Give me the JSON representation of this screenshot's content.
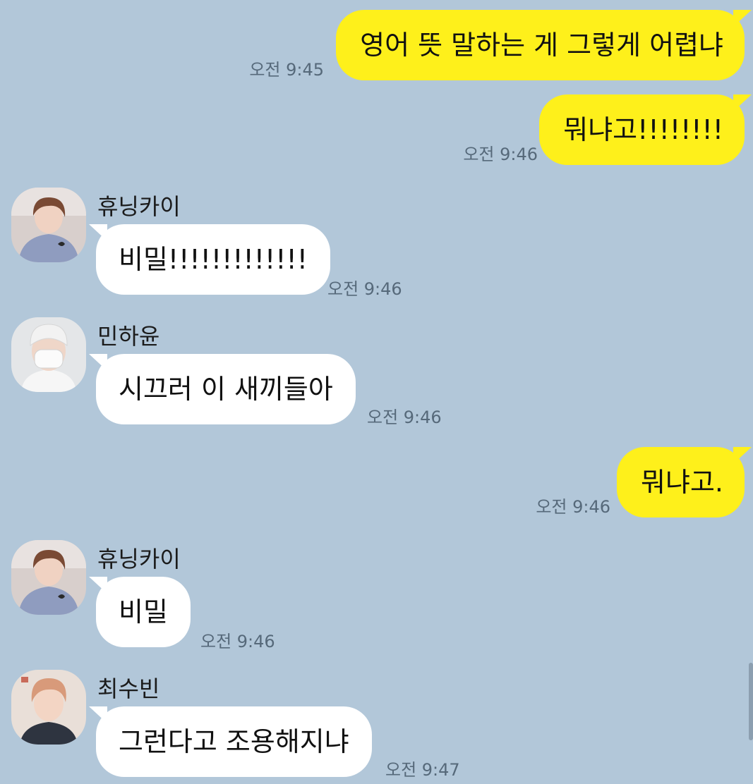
{
  "messages": [
    {
      "side": "out",
      "text": "영어 뜻 말하는 게 그렇게 어렵냐",
      "time": "오전 9:45"
    },
    {
      "side": "out",
      "text": "뭐냐고!!!!!!!!",
      "time": "오전 9:46"
    },
    {
      "side": "in",
      "sender": "휴닝카이",
      "avatar": "avatar-hueningkai",
      "text": "비밀!!!!!!!!!!!!!",
      "time": "오전 9:46"
    },
    {
      "side": "in",
      "sender": "민하윤",
      "avatar": "avatar-minhayun",
      "text": "시끄러 이 새끼들아",
      "time": "오전 9:46"
    },
    {
      "side": "out",
      "text": "뭐냐고.",
      "time": "오전 9:46"
    },
    {
      "side": "in",
      "sender": "휴닝카이",
      "avatar": "avatar-hueningkai",
      "text": "비밀",
      "time": "오전 9:46"
    },
    {
      "side": "in",
      "sender": "최수빈",
      "avatar": "avatar-choisoobin",
      "text": "그런다고 조용해지냐",
      "time": "오전 9:47"
    }
  ],
  "colors": {
    "background": "#b2c7d9",
    "outgoing_bubble": "#fef01b",
    "incoming_bubble": "#ffffff",
    "timestamp": "#56697a"
  }
}
